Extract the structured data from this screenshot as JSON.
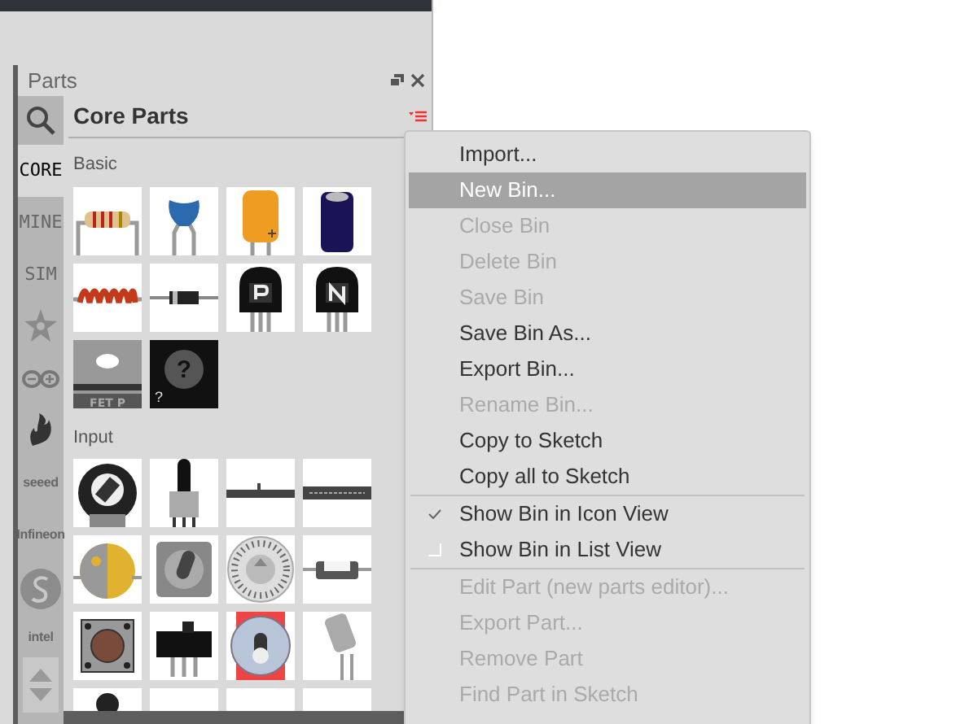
{
  "panel": {
    "title": "Parts"
  },
  "tabs": [
    {
      "kind": "search",
      "selected": false
    },
    {
      "kind": "text",
      "label": "CORE",
      "selected": true
    },
    {
      "kind": "text",
      "label": "MINE",
      "selected": false
    },
    {
      "kind": "text",
      "label": "SIM",
      "selected": false
    },
    {
      "kind": "logo",
      "selected": false
    },
    {
      "kind": "logo",
      "selected": false
    },
    {
      "kind": "logo",
      "selected": false
    },
    {
      "kind": "wordmark",
      "label": "seeed",
      "selected": false
    },
    {
      "kind": "wordmark",
      "label": "Infineon",
      "selected": false
    },
    {
      "kind": "logo",
      "selected": false
    },
    {
      "kind": "wordmark",
      "label": "intel",
      "selected": false
    }
  ],
  "bin": {
    "title": "Core Parts",
    "sections": [
      {
        "title": "Basic",
        "mystery_mark": "?",
        "fet_label": "FET P"
      },
      {
        "title": "Input"
      }
    ]
  },
  "menu": {
    "sections": [
      [
        {
          "label": "Import...",
          "disabled": false,
          "selected": false
        },
        {
          "label": "New Bin...",
          "disabled": false,
          "selected": true
        },
        {
          "label": "Close Bin",
          "disabled": true,
          "selected": false
        },
        {
          "label": "Delete Bin",
          "disabled": true,
          "selected": false
        },
        {
          "label": "Save Bin",
          "disabled": true,
          "selected": false
        },
        {
          "label": "Save Bin As...",
          "disabled": false,
          "selected": false
        },
        {
          "label": "Export Bin...",
          "disabled": false,
          "selected": false
        },
        {
          "label": "Rename Bin...",
          "disabled": true,
          "selected": false
        },
        {
          "label": "Copy to Sketch",
          "disabled": false,
          "selected": false
        },
        {
          "label": "Copy all to Sketch",
          "disabled": false,
          "selected": false
        }
      ],
      [
        {
          "label": "Show Bin in Icon View",
          "disabled": false,
          "selected": false,
          "checked": true
        },
        {
          "label": "Show Bin in List View",
          "disabled": false,
          "selected": false,
          "checked": false
        }
      ],
      [
        {
          "label": "Edit Part (new parts editor)...",
          "disabled": true,
          "selected": false
        },
        {
          "label": "Export Part...",
          "disabled": true,
          "selected": false
        },
        {
          "label": "Remove Part",
          "disabled": true,
          "selected": false
        },
        {
          "label": "Find Part in Sketch",
          "disabled": true,
          "selected": false
        }
      ]
    ]
  }
}
